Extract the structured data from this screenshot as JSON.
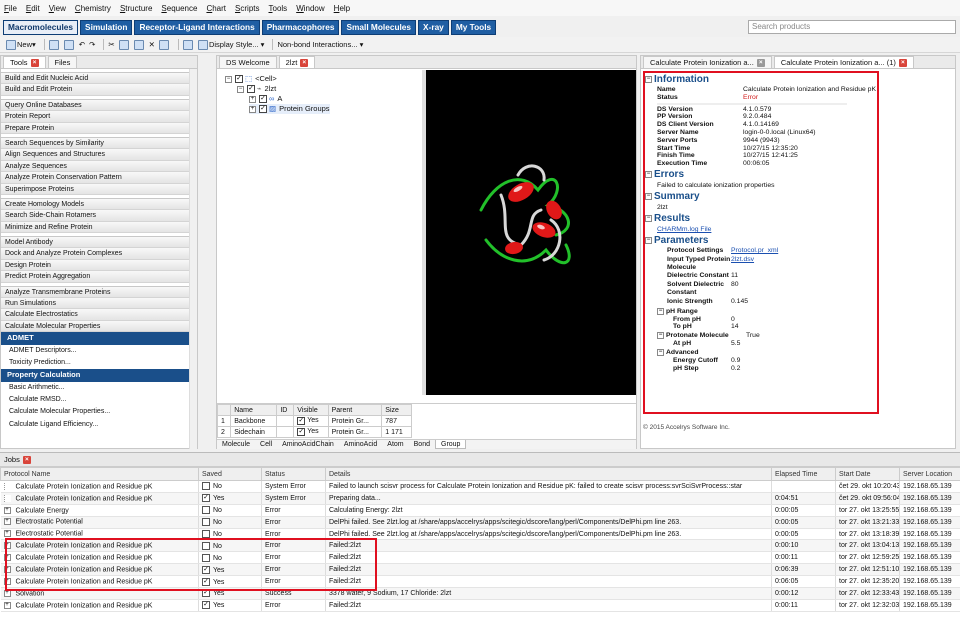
{
  "menu": [
    "File",
    "Edit",
    "View",
    "Chemistry",
    "Structure",
    "Sequence",
    "Chart",
    "Scripts",
    "Tools",
    "Window",
    "Help"
  ],
  "main_tabs": [
    "Macromolecules",
    "Simulation",
    "Receptor-Ligand Interactions",
    "Pharmacophores",
    "Small Molecules",
    "X-ray",
    "My Tools"
  ],
  "search_placeholder": "Search products",
  "toolbar": {
    "new_label": "New",
    "display_style": "Display Style...",
    "nonbond": "Non-bond Interactions..."
  },
  "left": {
    "tab_tools": "Tools",
    "tab_files": "Files",
    "groups": [
      [
        "Build and Edit Nucleic Acid",
        "Build and Edit Protein"
      ],
      [
        "Query Online Databases",
        "Protein Report",
        "Prepare Protein"
      ],
      [
        "Search Sequences by Similarity",
        "Align Sequences and Structures",
        "Analyze Sequences",
        "Analyze Protein Conservation Pattern",
        "Superimpose Proteins"
      ],
      [
        "Create Homology Models",
        "Search Side-Chain Rotamers",
        "Minimize and Refine Protein"
      ],
      [
        "Model Antibody",
        "Dock and Analyze Protein Complexes",
        "Design Protein",
        "Predict Protein Aggregation"
      ],
      [
        "Analyze Transmembrane Proteins",
        "Run Simulations",
        "Calculate Electrostatics",
        "Calculate Molecular Properties"
      ]
    ],
    "admet": {
      "title": "ADMET",
      "items": [
        "ADMET Descriptors...",
        "Toxicity Prediction..."
      ]
    },
    "propcalc": {
      "title": "Property Calculation",
      "items": [
        "Basic Arithmetic...",
        "Calculate RMSD...",
        "Calculate Molecular Properties...",
        "Calculate Ligand Efficiency..."
      ]
    }
  },
  "center": {
    "tab_welcome": "DS Welcome",
    "tab_2lzt": "2lzt",
    "tree": {
      "cell": "<Cell>",
      "mol": "2lzt",
      "chain": "A",
      "groups": "Protein Groups"
    },
    "grid": {
      "headers": [
        "",
        "Name",
        "ID",
        "Visible",
        "Parent",
        "Size"
      ],
      "rows": [
        [
          "1",
          "Backbone",
          "",
          "Yes",
          "Protein Gr...",
          "787"
        ],
        [
          "2",
          "Sidechain",
          "",
          "Yes",
          "Protein Gr...",
          "1 171"
        ]
      ]
    },
    "bottom_tabs": [
      "Molecule",
      "Cell",
      "AminoAcidChain",
      "AminoAcid",
      "Atom",
      "Bond",
      "Group"
    ]
  },
  "right": {
    "tab1": "Calculate Protein Ionization a...",
    "tab2": "Calculate Protein Ionization a... (1)",
    "info_title": "Information",
    "info": [
      {
        "k": "Name",
        "v": "Calculate Protein Ionization and Residue pK"
      },
      {
        "k": "Status",
        "v": "Error"
      },
      {
        "k": "DS Version",
        "v": "4.1.0.579"
      },
      {
        "k": "PP Version",
        "v": "9.2.0.484"
      },
      {
        "k": "DS Client Version",
        "v": "4.1.0.14169"
      },
      {
        "k": "Server Name",
        "v": "login-0-0.local (Linux64)"
      },
      {
        "k": "Server Ports",
        "v": "9944 (9943)"
      },
      {
        "k": "Start Time",
        "v": "10/27/15 12:35:20"
      },
      {
        "k": "Finish Time",
        "v": "10/27/15 12:41:25"
      },
      {
        "k": "Execution Time",
        "v": "00:06:05"
      }
    ],
    "errors_title": "Errors",
    "errors_text": "Failed to calculate ionization properties",
    "summary_title": "Summary",
    "summary_text": "2lzt",
    "results_title": "Results",
    "results_link": "CHARMm.log File",
    "params_title": "Parameters",
    "params": [
      {
        "k": "Protocol Settings",
        "v": "Protocol.pr_xml"
      },
      {
        "k": "Input Typed Protein Molecule",
        "v": "2lzt.dsv"
      },
      {
        "k": "Dielectric Constant",
        "v": "11"
      },
      {
        "k": "Solvent Dielectric Constant",
        "v": "80"
      },
      {
        "k": "Ionic Strength",
        "v": "0.145"
      }
    ],
    "ph_range": "pH Range",
    "ph": [
      {
        "k": "From pH",
        "v": "0"
      },
      {
        "k": "To pH",
        "v": "14"
      }
    ],
    "protonate": {
      "k": "Protonate Molecule",
      "v": "True"
    },
    "atph": {
      "k": "At pH",
      "v": "5.5"
    },
    "advanced": "Advanced",
    "adv": [
      {
        "k": "Energy Cutoff",
        "v": "0.9"
      },
      {
        "k": "pH Step",
        "v": "0.2"
      }
    ],
    "copyright": "© 2015 Accelrys Software Inc."
  },
  "jobs": {
    "tab": "Jobs",
    "headers": [
      "Protocol Name",
      "Saved",
      "Status",
      "Details",
      "Elapsed Time",
      "Start Date",
      "Server Location"
    ],
    "rows": [
      [
        "Calculate Protein Ionization and Residue pK",
        "No",
        "System Error",
        "Failed to launch scisvr process for Calculate Protein Ionization and Residue pK: failed to create scisvr process:svrSciSvrProcess::star",
        "",
        "čet 29. okt 10:20:43",
        "192.168.65.139"
      ],
      [
        "Calculate Protein Ionization and Residue pK",
        "Yes",
        "System Error",
        "Preparing data...",
        "0:04:51",
        "čet 29. okt 09:56:04",
        "192.168.65.139"
      ],
      [
        "Calculate Energy",
        "No",
        "Error",
        "Calculating Energy: 2lzt",
        "0:00:05",
        "tor 27. okt 13:25:55",
        "192.168.65.139"
      ],
      [
        "Electrostatic Potential",
        "No",
        "Error",
        "DelPhi failed. See 2lzt.log at /share/apps/accelrys/apps/scitegic/dscore/lang/perl/Components/DelPhi.pm line 263.",
        "0:00:05",
        "tor 27. okt 13:21:33",
        "192.168.65.139"
      ],
      [
        "Electrostatic Potential",
        "No",
        "Error",
        "DelPhi failed. See 2lzt.log at /share/apps/accelrys/apps/scitegic/dscore/lang/perl/Components/DelPhi.pm line 263.",
        "0:00:05",
        "tor 27. okt 13:18:39",
        "192.168.65.139"
      ],
      [
        "Calculate Protein Ionization and Residue pK",
        "No",
        "Error",
        "Failed:2lzt",
        "0:00:10",
        "tor 27. okt 13:04:13",
        "192.168.65.139"
      ],
      [
        "Calculate Protein Ionization and Residue pK",
        "No",
        "Error",
        "Failed:2lzt",
        "0:00:11",
        "tor 27. okt 12:59:25",
        "192.168.65.139"
      ],
      [
        "Calculate Protein Ionization and Residue pK",
        "Yes",
        "Error",
        "Failed:2lzt",
        "0:06:39",
        "tor 27. okt 12:51:10",
        "192.168.65.139"
      ],
      [
        "Calculate Protein Ionization and Residue pK",
        "Yes",
        "Error",
        "Failed:2lzt",
        "0:06:05",
        "tor 27. okt 12:35:20",
        "192.168.65.139"
      ],
      [
        "Solvation",
        "Yes",
        "Success",
        "3378 water, 9 Sodium, 17 Chloride: 2lzt",
        "0:00:12",
        "tor 27. okt 12:33:43",
        "192.168.65.139"
      ],
      [
        "Calculate Protein Ionization and Residue pK",
        "Yes",
        "Error",
        "Failed:2lzt",
        "0:00:11",
        "tor 27. okt 12:32:03",
        "192.168.65.139"
      ]
    ]
  }
}
